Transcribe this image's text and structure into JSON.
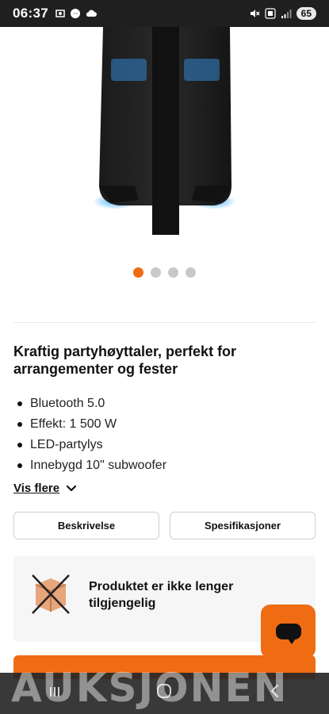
{
  "status_bar": {
    "time": "06:37",
    "battery": "65"
  },
  "gallery": {
    "dots": [
      true,
      false,
      false,
      false
    ]
  },
  "product": {
    "title": "Kraftig partyhøyttaler, perfekt for arrangementer og fester",
    "features": [
      "Bluetooth 5.0",
      "Effekt: 1 500 W",
      "LED-partylys",
      "Innebygd 10\" subwoofer"
    ],
    "show_more": "Vis flere"
  },
  "tabs": {
    "description": "Beskrivelse",
    "specifications": "Spesifikasjoner"
  },
  "availability": {
    "message": "Produktet er ikke lenger tilgjengelig"
  },
  "watermark": "AUKSJONEN",
  "colors": {
    "accent": "#ef6c12",
    "status_bar": "#1f1f1f"
  },
  "icons": {
    "chat": "chat-icon",
    "unavailable": "crossed-box-icon",
    "show_more": "chevron-down-icon"
  }
}
